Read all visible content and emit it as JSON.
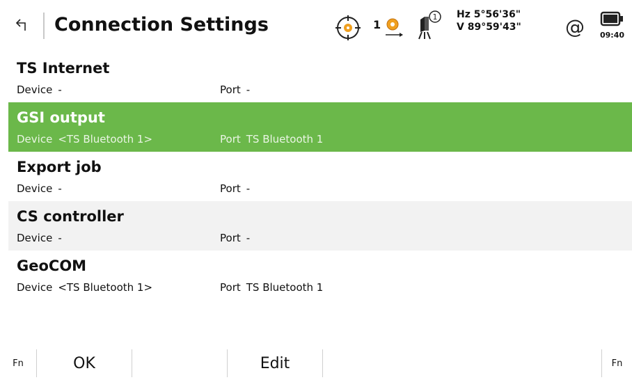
{
  "header": {
    "title": "Connection Settings",
    "back_icon": "back-arrow-icon",
    "prism_constant": "1",
    "hz_angle": "Hz 5°56'36\"",
    "v_angle": "V  89°59'43\"",
    "at_symbol": "@",
    "time": "09:40"
  },
  "connections": [
    {
      "name": "TS Internet",
      "device_label": "Device",
      "device_value": "-",
      "port_label": "Port",
      "port_value": "-"
    },
    {
      "name": "GSI output",
      "device_label": "Device",
      "device_value": "<TS Bluetooth 1>",
      "port_label": "Port",
      "port_value": "TS Bluetooth 1"
    },
    {
      "name": "Export job",
      "device_label": "Device",
      "device_value": "-",
      "port_label": "Port",
      "port_value": "-"
    },
    {
      "name": "CS controller",
      "device_label": "Device",
      "device_value": "-",
      "port_label": "Port",
      "port_value": "-"
    },
    {
      "name": "GeoCOM",
      "device_label": "Device",
      "device_value": "<TS Bluetooth 1>",
      "port_label": "Port",
      "port_value": "TS Bluetooth 1"
    }
  ],
  "selected_index": 1,
  "softkeys": {
    "fn_left": "Fn",
    "ok": "OK",
    "edit": "Edit",
    "fn_right": "Fn"
  },
  "colors": {
    "selected_row": "#6bb84a",
    "alt_row": "#f2f2f2",
    "prism_orange": "#f0a020"
  }
}
